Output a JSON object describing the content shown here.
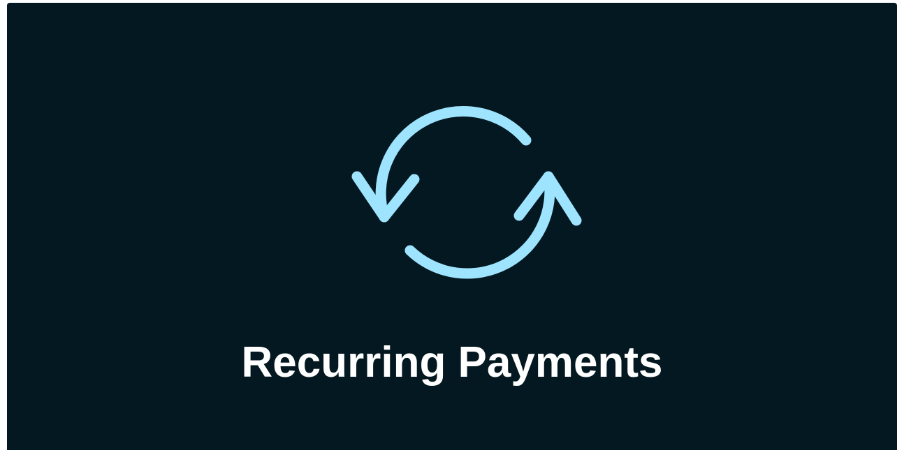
{
  "banner": {
    "title": "Recurring Payments",
    "icon": "refresh-cycle-icon",
    "colors": {
      "background": "#031820",
      "icon": "#9fe4ff",
      "title": "#ffffff"
    }
  }
}
